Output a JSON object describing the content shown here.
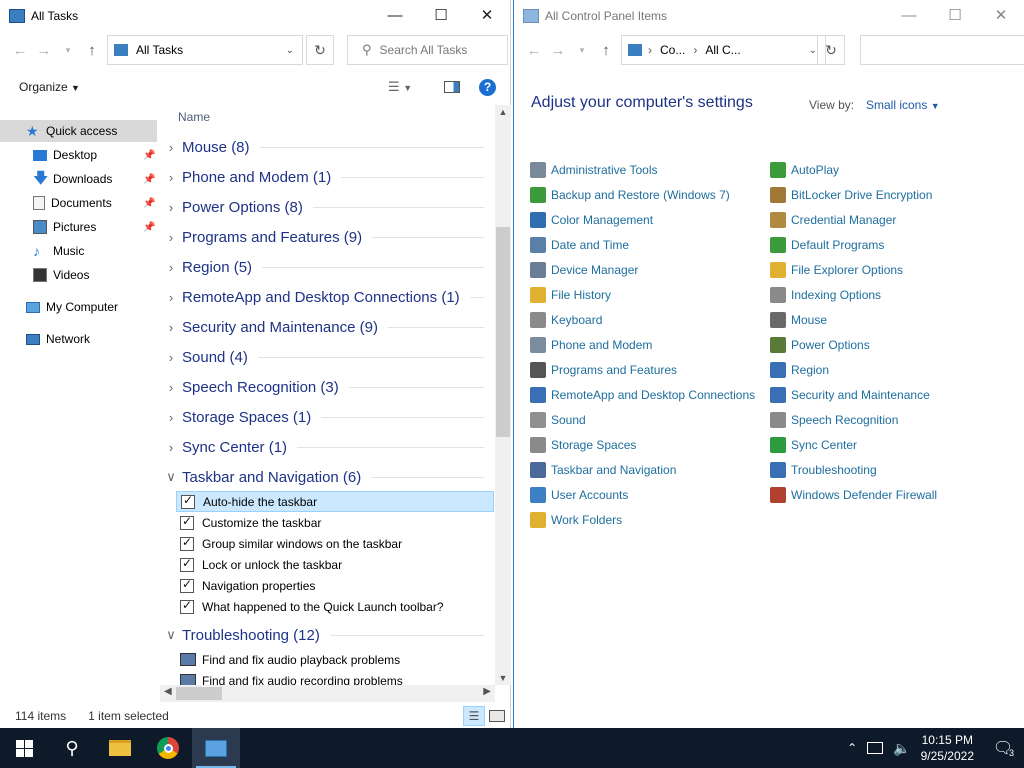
{
  "left_window": {
    "title": "All Tasks",
    "address": "All Tasks",
    "search_placeholder": "Search All Tasks",
    "organize_label": "Organize",
    "column_header": "Name",
    "status_items": "114 items",
    "status_selected": "1 item selected",
    "nav": {
      "quick_access": "Quick access",
      "desktop": "Desktop",
      "downloads": "Downloads",
      "documents": "Documents",
      "pictures": "Pictures",
      "music": "Music",
      "videos": "Videos",
      "my_computer": "My Computer",
      "network": "Network"
    },
    "groups": [
      {
        "label": "Mouse (8)",
        "expanded": false
      },
      {
        "label": "Phone and Modem (1)",
        "expanded": false
      },
      {
        "label": "Power Options (8)",
        "expanded": false
      },
      {
        "label": "Programs and Features (9)",
        "expanded": false
      },
      {
        "label": "Region (5)",
        "expanded": false
      },
      {
        "label": "RemoteApp and Desktop Connections (1)",
        "expanded": false
      },
      {
        "label": "Security and Maintenance (9)",
        "expanded": false
      },
      {
        "label": "Sound (4)",
        "expanded": false
      },
      {
        "label": "Speech Recognition (3)",
        "expanded": false
      },
      {
        "label": "Storage Spaces (1)",
        "expanded": false
      },
      {
        "label": "Sync Center (1)",
        "expanded": false
      },
      {
        "label": "Taskbar and Navigation (6)",
        "expanded": true
      },
      {
        "label": "Troubleshooting (12)",
        "expanded": true
      }
    ],
    "taskbar_tasks": [
      "Auto-hide the taskbar",
      "Customize the taskbar",
      "Group similar windows on the taskbar",
      "Lock or unlock the taskbar",
      "Navigation properties",
      "What happened to the Quick Launch toolbar?"
    ],
    "troubleshooting_tasks": [
      "Find and fix audio playback problems",
      "Find and fix audio recording problems"
    ]
  },
  "right_window": {
    "title": "All Control Panel Items",
    "breadcrumb_1": "Co...",
    "breadcrumb_2": "All C...",
    "heading": "Adjust your computer's settings",
    "view_by_label": "View by:",
    "view_by_value": "Small icons",
    "items_col1": [
      {
        "label": "Administrative Tools",
        "color": "#7a8a99"
      },
      {
        "label": "Backup and Restore (Windows 7)",
        "color": "#3c9a3c"
      },
      {
        "label": "Color Management",
        "color": "#2f6fb0"
      },
      {
        "label": "Date and Time",
        "color": "#5c7fa8"
      },
      {
        "label": "Device Manager",
        "color": "#6a7f95"
      },
      {
        "label": "File History",
        "color": "#e0b030"
      },
      {
        "label": "Keyboard",
        "color": "#8a8a8a"
      },
      {
        "label": "Phone and Modem",
        "color": "#7b8c9c"
      },
      {
        "label": "Programs and Features",
        "color": "#555555"
      },
      {
        "label": "RemoteApp and Desktop Connections",
        "color": "#3a6fb5"
      },
      {
        "label": "Sound",
        "color": "#909090"
      },
      {
        "label": "Storage Spaces",
        "color": "#8a8a8a"
      },
      {
        "label": "Taskbar and Navigation",
        "color": "#4a6a9a"
      },
      {
        "label": "User Accounts",
        "color": "#3d7fc4"
      },
      {
        "label": "Work Folders",
        "color": "#e0b030"
      }
    ],
    "items_col2": [
      {
        "label": "AutoPlay",
        "color": "#3c9a3c"
      },
      {
        "label": "BitLocker Drive Encryption",
        "color": "#a07838"
      },
      {
        "label": "Credential Manager",
        "color": "#b08a40"
      },
      {
        "label": "Default Programs",
        "color": "#3c9a3c"
      },
      {
        "label": "File Explorer Options",
        "color": "#e0b030"
      },
      {
        "label": "Indexing Options",
        "color": "#8a8a8a"
      },
      {
        "label": "Mouse",
        "color": "#6a6a6a"
      },
      {
        "label": "Power Options",
        "color": "#5a7a3a"
      },
      {
        "label": "Region",
        "color": "#3a6fb5"
      },
      {
        "label": "Security and Maintenance",
        "color": "#3a6fb5"
      },
      {
        "label": "Speech Recognition",
        "color": "#8a8a8a"
      },
      {
        "label": "Sync Center",
        "color": "#2e9a3e"
      },
      {
        "label": "Troubleshooting",
        "color": "#3a6fb5"
      },
      {
        "label": "Windows Defender Firewall",
        "color": "#b04030"
      }
    ]
  },
  "taskbar": {
    "time": "10:15 PM",
    "date": "9/25/2022",
    "notification_count": "3"
  }
}
